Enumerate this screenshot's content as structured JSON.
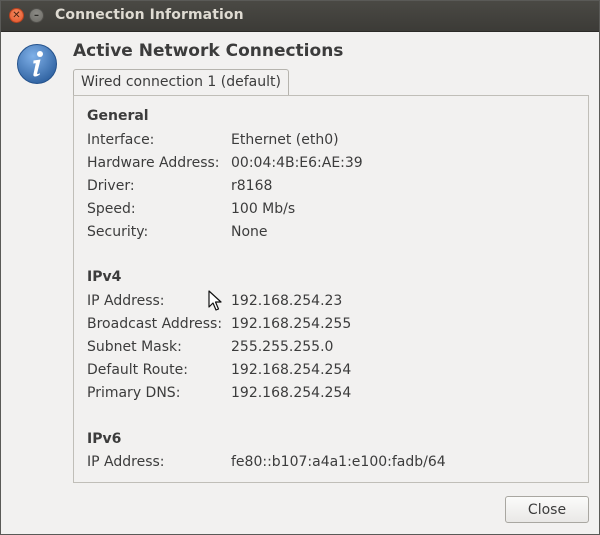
{
  "window": {
    "title": "Connection Information"
  },
  "heading": "Active Network Connections",
  "tab_label": "Wired connection 1 (default)",
  "sections": {
    "general": {
      "title": "General",
      "rows": [
        {
          "label": "Interface:",
          "value": "Ethernet (eth0)"
        },
        {
          "label": "Hardware Address:",
          "value": "00:04:4B:E6:AE:39"
        },
        {
          "label": "Driver:",
          "value": "r8168"
        },
        {
          "label": "Speed:",
          "value": "100 Mb/s"
        },
        {
          "label": "Security:",
          "value": "None"
        }
      ]
    },
    "ipv4": {
      "title": "IPv4",
      "rows": [
        {
          "label": "IP Address:",
          "value": "192.168.254.23"
        },
        {
          "label": "Broadcast Address:",
          "value": "192.168.254.255"
        },
        {
          "label": "Subnet Mask:",
          "value": "255.255.255.0"
        },
        {
          "label": "Default Route:",
          "value": "192.168.254.254"
        },
        {
          "label": "Primary DNS:",
          "value": "192.168.254.254"
        }
      ]
    },
    "ipv6": {
      "title": "IPv6",
      "rows": [
        {
          "label": "IP Address:",
          "value": "fe80::b107:a4a1:e100:fadb/64"
        }
      ]
    }
  },
  "buttons": {
    "close_label": "Close"
  },
  "icons": {
    "window_close": "close-icon",
    "window_minimize": "minimize-icon",
    "info": "info-icon",
    "cursor": "text-cursor-icon"
  },
  "colors": {
    "titlebar": "#3c3b37",
    "close_button": "#e3542b",
    "info_icon": "#3b73b9"
  }
}
